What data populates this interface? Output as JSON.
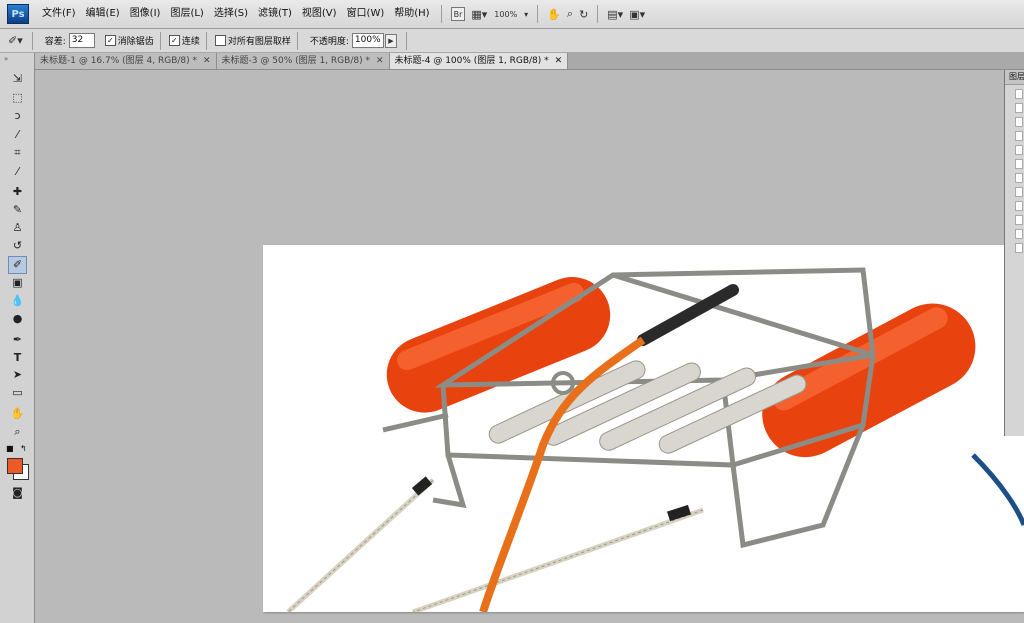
{
  "app": {
    "logo": "Ps"
  },
  "menu": [
    "文件(F)",
    "编辑(E)",
    "图像(I)",
    "图层(L)",
    "选择(S)",
    "滤镜(T)",
    "视图(V)",
    "窗口(W)",
    "帮助(H)"
  ],
  "menubar_tools": {
    "bridge": "Br",
    "zoom": "100%"
  },
  "options": {
    "tolerance_label": "容差:",
    "tolerance_value": "32",
    "antialias_label": "消除锯齿",
    "contiguous_label": "连续",
    "sample_all_label": "对所有图层取样",
    "opacity_label": "不透明度:",
    "opacity_value": "100%"
  },
  "tabs": [
    {
      "label": "未标题-1 @ 16.7% (图层 4, RGB/8) *"
    },
    {
      "label": "未标题-3 @ 50% (图层 1, RGB/8) *"
    },
    {
      "label": "未标题-4 @ 100% (图层 1, RGB/8) *"
    }
  ],
  "tools": [
    "move-tool-icon",
    "marquee-tool-icon",
    "lasso-tool-icon",
    "quick-select-tool-icon",
    "crop-tool-icon",
    "eyedropper-tool-icon",
    "healing-brush-icon",
    "brush-tool-icon",
    "clone-stamp-icon",
    "history-brush-icon",
    "magic-eraser-icon",
    "gradient-tool-icon",
    "blur-tool-icon",
    "dodge-tool-icon",
    "pen-tool-icon",
    "type-tool-icon",
    "path-select-icon",
    "shape-tool-icon",
    "hand-tool-icon",
    "zoom-tool-icon"
  ],
  "colors": {
    "foreground": "#ec5a2a",
    "background": "#ffffff"
  },
  "panel": {
    "title": "图层"
  }
}
